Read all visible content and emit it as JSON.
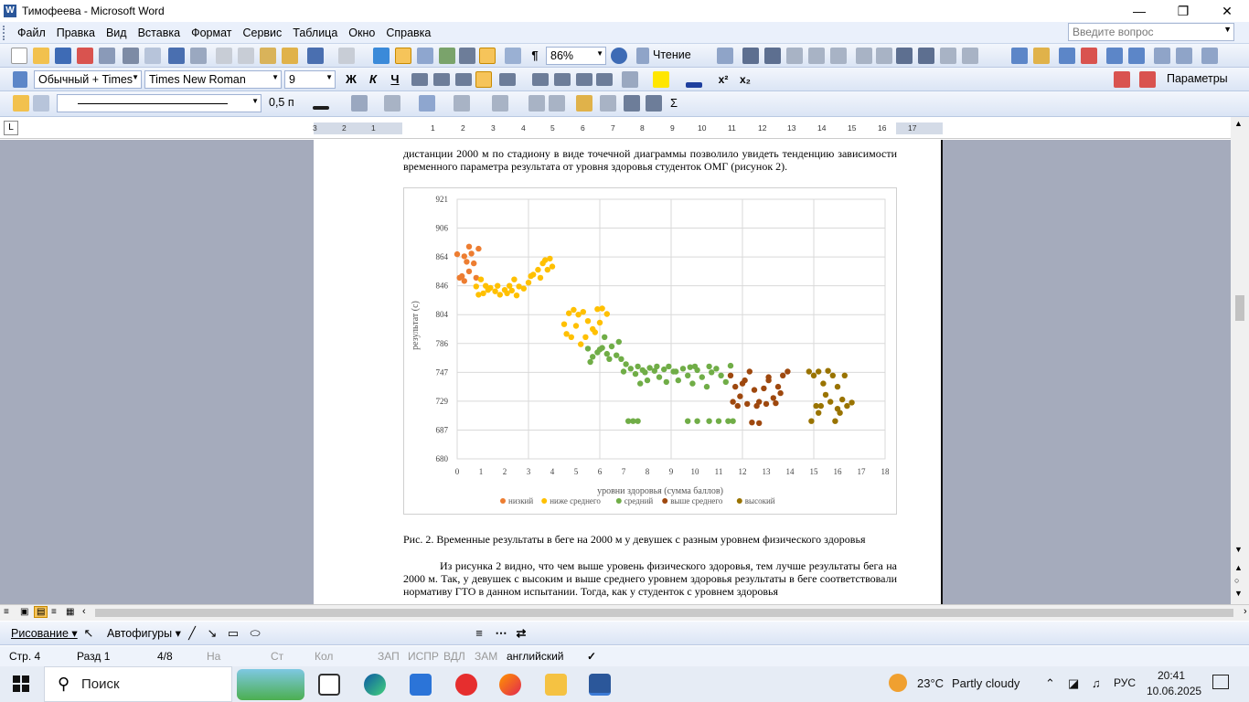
{
  "window": {
    "title": "Тимофеева - Microsoft Word",
    "app_glyph": "W"
  },
  "menu": {
    "items": [
      "Файл",
      "Правка",
      "Вид",
      "Вставка",
      "Формат",
      "Сервис",
      "Таблица",
      "Окно",
      "Справка"
    ],
    "ask_placeholder": "Введите вопрос"
  },
  "toolbar": {
    "zoom": "86%",
    "reading_label": "Чтение",
    "style": "Обычный + Times",
    "font": "Times New Roman",
    "size": "9",
    "bold": "Ж",
    "italic": "К",
    "underline": "Ч",
    "params_label": "Параметры",
    "line_width": "0,5 п"
  },
  "ruler": {
    "labels": [
      "3",
      "2",
      "1",
      "1",
      "2",
      "3",
      "4",
      "5",
      "6",
      "7",
      "8",
      "9",
      "10",
      "11",
      "12",
      "13",
      "14",
      "15",
      "16",
      "17"
    ],
    "tab_symbol": "L"
  },
  "document": {
    "para_top": "дистанции 2000 м по стадиону в виде точечной диаграммы позволило увидеть тенденцию зависимости временного параметра результата от уровня здоровья студенток ОМГ (рисунок 2).",
    "caption": "Рис. 2. Временные результаты в беге на 2000 м у девушек с разным уровнем физического здоровья",
    "para_bottom": "Из рисунка 2 видно, что чем выше уровень физического здоровья, тем лучше результаты бега на 2000 м. Так, у девушек с высоким и выше среднего уровнем здоровья результаты в беге соответствовали нормативу ГТО в данном испытании. Тогда, как у студенток с уровнем здоровья"
  },
  "chart_data": {
    "type": "scatter",
    "xlabel": "уровни здоровья (сумма баллов)",
    "ylabel": "результат (с)",
    "x_ticks": [
      0,
      1,
      2,
      3,
      4,
      5,
      6,
      7,
      8,
      9,
      10,
      11,
      12,
      13,
      14,
      15,
      16,
      17,
      18
    ],
    "y_ticks": [
      680,
      687,
      729,
      747,
      786,
      804,
      846,
      864,
      906,
      921
    ],
    "xlim": [
      0,
      18
    ],
    "grid": true,
    "legend_position": "bottom",
    "series": [
      {
        "name": "низкий",
        "color": "#ed7d31",
        "points": [
          [
            0.0,
            868
          ],
          [
            0.1,
            851
          ],
          [
            0.2,
            852
          ],
          [
            0.3,
            849
          ],
          [
            0.4,
            861
          ],
          [
            0.5,
            879
          ],
          [
            0.6,
            869
          ],
          [
            0.7,
            860
          ],
          [
            0.8,
            851
          ],
          [
            0.9,
            876
          ],
          [
            0.5,
            855
          ],
          [
            0.3,
            865
          ]
        ]
      },
      {
        "name": "ниже среднего",
        "color": "#ffc000",
        "points": [
          [
            0.8,
            845
          ],
          [
            1.0,
            850
          ],
          [
            1.2,
            846
          ],
          [
            1.4,
            843
          ],
          [
            1.6,
            838
          ],
          [
            1.8,
            833
          ],
          [
            2.0,
            840
          ],
          [
            2.2,
            846
          ],
          [
            2.4,
            850
          ],
          [
            2.6,
            845
          ],
          [
            2.8,
            842
          ],
          [
            3.0,
            848
          ],
          [
            3.2,
            853
          ],
          [
            3.4,
            856
          ],
          [
            3.6,
            860
          ],
          [
            3.8,
            856
          ],
          [
            4.0,
            858
          ],
          [
            3.9,
            863
          ],
          [
            3.5,
            851
          ],
          [
            1.1,
            835
          ],
          [
            1.3,
            840
          ],
          [
            1.7,
            846
          ],
          [
            2.1,
            835
          ],
          [
            2.5,
            832
          ],
          [
            0.9,
            833
          ],
          [
            3.1,
            852
          ],
          [
            3.7,
            862
          ],
          [
            2.3,
            839
          ],
          [
            4.5,
            798
          ],
          [
            4.7,
            806
          ],
          [
            4.9,
            811
          ],
          [
            5.1,
            804
          ],
          [
            5.3,
            808
          ],
          [
            5.5,
            800
          ],
          [
            5.7,
            795
          ],
          [
            5.9,
            812
          ],
          [
            6.1,
            813
          ],
          [
            6.3,
            805
          ],
          [
            4.6,
            792
          ],
          [
            5.0,
            797
          ],
          [
            5.4,
            790
          ],
          [
            5.8,
            793
          ],
          [
            6.0,
            799
          ],
          [
            5.2,
            785
          ],
          [
            4.8,
            790
          ]
        ]
      },
      {
        "name": "средний",
        "color": "#70ad47",
        "points": [
          [
            5.5,
            779
          ],
          [
            5.7,
            768
          ],
          [
            5.9,
            774
          ],
          [
            6.1,
            780
          ],
          [
            6.3,
            772
          ],
          [
            6.5,
            782
          ],
          [
            6.7,
            770
          ],
          [
            6.9,
            765
          ],
          [
            7.1,
            758
          ],
          [
            7.3,
            752
          ],
          [
            7.5,
            746
          ],
          [
            7.7,
            740
          ],
          [
            7.9,
            747
          ],
          [
            8.1,
            753
          ],
          [
            8.3,
            749
          ],
          [
            8.5,
            744
          ],
          [
            8.7,
            751
          ],
          [
            8.9,
            755
          ],
          [
            9.1,
            748
          ],
          [
            9.3,
            742
          ],
          [
            9.5,
            752
          ],
          [
            9.7,
            745
          ],
          [
            9.9,
            740
          ],
          [
            10.1,
            750
          ],
          [
            10.3,
            744
          ],
          [
            10.5,
            738
          ],
          [
            10.7,
            747
          ],
          [
            10.9,
            752
          ],
          [
            11.1,
            745
          ],
          [
            11.3,
            741
          ],
          [
            11.5,
            756
          ],
          [
            6.4,
            765
          ],
          [
            7.0,
            748
          ],
          [
            8.4,
            755
          ],
          [
            9.8,
            754
          ],
          [
            10.6,
            755
          ],
          [
            7.6,
            755
          ],
          [
            8.8,
            741
          ],
          [
            6.8,
            787
          ],
          [
            6.2,
            790
          ],
          [
            7.2,
            700
          ],
          [
            7.4,
            700
          ],
          [
            7.6,
            700
          ],
          [
            9.7,
            700
          ],
          [
            10.1,
            700
          ],
          [
            10.6,
            700
          ],
          [
            11.0,
            700
          ],
          [
            11.4,
            700
          ],
          [
            11.6,
            700
          ],
          [
            5.6,
            761
          ],
          [
            6.0,
            778
          ],
          [
            9.2,
            748
          ],
          [
            10.0,
            755
          ],
          [
            8.0,
            742
          ],
          [
            7.8,
            750
          ]
        ]
      },
      {
        "name": "выше среднего",
        "color": "#9e480e",
        "points": [
          [
            11.5,
            745
          ],
          [
            11.7,
            738
          ],
          [
            11.9,
            732
          ],
          [
            12.1,
            742
          ],
          [
            12.3,
            748
          ],
          [
            12.5,
            736
          ],
          [
            12.7,
            728
          ],
          [
            12.9,
            737
          ],
          [
            13.1,
            744
          ],
          [
            13.3,
            731
          ],
          [
            13.5,
            738
          ],
          [
            13.7,
            745
          ],
          [
            13.9,
            748
          ],
          [
            12.2,
            725
          ],
          [
            12.6,
            722
          ],
          [
            13.0,
            725
          ],
          [
            13.4,
            726
          ],
          [
            11.6,
            728
          ],
          [
            11.8,
            722
          ],
          [
            12.4,
            698
          ],
          [
            12.7,
            697
          ],
          [
            13.1,
            742
          ],
          [
            12.0,
            740
          ],
          [
            13.6,
            734
          ]
        ]
      },
      {
        "name": "высокий",
        "color": "#997300",
        "points": [
          [
            14.8,
            748
          ],
          [
            15.0,
            745
          ],
          [
            15.2,
            748
          ],
          [
            15.4,
            740
          ],
          [
            15.6,
            749
          ],
          [
            15.8,
            745
          ],
          [
            16.0,
            738
          ],
          [
            16.2,
            730
          ],
          [
            16.4,
            722
          ],
          [
            16.6,
            727
          ],
          [
            15.3,
            722
          ],
          [
            15.7,
            728
          ],
          [
            16.1,
            712
          ],
          [
            15.9,
            700
          ],
          [
            14.9,
            700
          ],
          [
            15.1,
            722
          ],
          [
            15.5,
            733
          ],
          [
            16.3,
            745
          ],
          [
            15.2,
            712
          ],
          [
            16.0,
            718
          ]
        ]
      }
    ]
  }
}
